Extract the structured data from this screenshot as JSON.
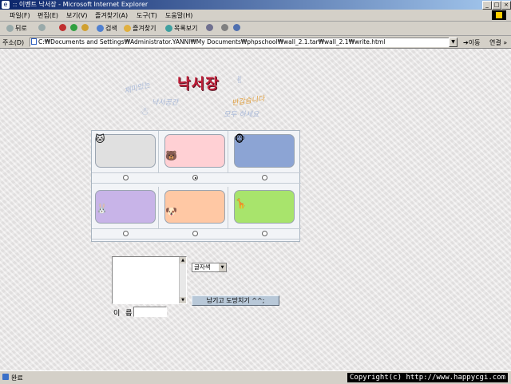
{
  "window": {
    "title": ":: 이벤트 낙서장 - Microsoft Internet Explorer",
    "controls": {
      "minimize": "_",
      "maximize": "□",
      "close": "×"
    }
  },
  "menu": [
    "파일(F)",
    "편집(E)",
    "보기(V)",
    "즐겨찾기(A)",
    "도구(T)",
    "도움말(H)"
  ],
  "toolbar": {
    "back": "뒤로",
    "search": "검색",
    "favorites": "즐겨찾기",
    "history": "목록보기"
  },
  "address": {
    "label": "주소(D)",
    "url": "C:₩Documents and Settings₩Administrator.YANNI₩My Documents₩phpschool₩wall_2.1.tar₩wall_2.1₩write.html",
    "go": "이동",
    "links": "연결 »"
  },
  "page": {
    "logo_title": "낙서장",
    "doodles": [
      "재미있는",
      "낙서공간",
      "반갑습니다",
      "모두 하세요"
    ],
    "palette": [
      {
        "color": "#e0e0e0",
        "critter": "cat-icon",
        "glyph": "🐱",
        "selected": false
      },
      {
        "color": "#ffd0d4",
        "critter": "bear-icon",
        "glyph": "🐻",
        "selected": true
      },
      {
        "color": "#8ca4d4",
        "critter": "monkey-icon",
        "glyph": "🐵",
        "selected": false
      },
      {
        "color": "#c8b4e8",
        "critter": "rabbit-icon",
        "glyph": "🐰",
        "selected": false
      },
      {
        "color": "#ffc8a4",
        "critter": "dog-icon",
        "glyph": "🐶",
        "selected": false
      },
      {
        "color": "#a8e46c",
        "critter": "giraffe-icon",
        "glyph": "🦒",
        "selected": false
      }
    ],
    "color_select": "글자색",
    "submit_label": "남기고 도망치기 ^^;",
    "name_label": "이 름"
  },
  "status": {
    "text": "완료",
    "copyright": "Copyright(c) http://www.happycgi.com"
  }
}
